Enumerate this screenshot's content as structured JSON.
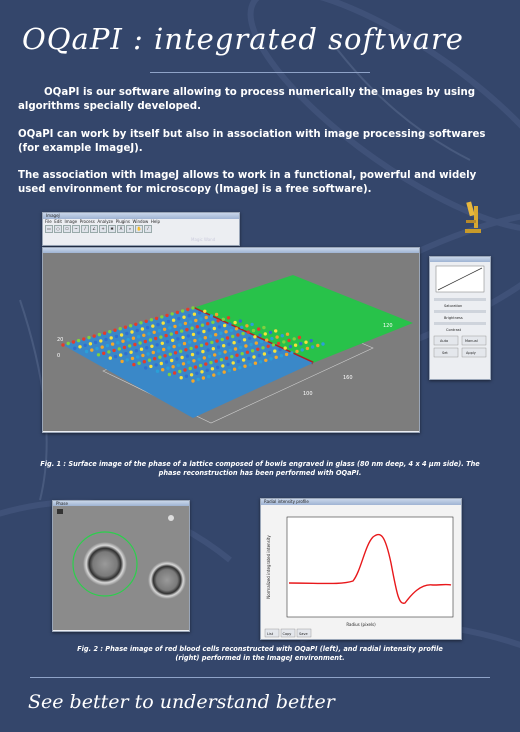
{
  "title": "OQaPI : integrated software",
  "paragraphs": [
    "OQaPI is our software allowing to process numerically the images by using algorithms specially developed.",
    "OQaPI can work by itself but also in association with image processing softwares (for example ImageJ).",
    "The association with ImageJ allows to work in a functional, powerful and widely used environment for microscopy (ImageJ is a free software)."
  ],
  "figure1": {
    "imagej_title": "ImageJ",
    "imagej_menu": [
      "File",
      "Edit",
      "Image",
      "Process",
      "Analyze",
      "Plugins",
      "Window",
      "Help"
    ],
    "imagej_status": "Magic Wand",
    "caption": "Fig. 1 : Surface image of the phase of a lattice composed of bowls engraved in glass (80 nm deep, 4 x 4 µm side). The phase reconstruction has been performed with OQaPI.",
    "axis_labels": [
      "120",
      "160",
      "100",
      "20",
      "0"
    ],
    "panel_labels": [
      "Saturation",
      "Brightness",
      "Contrast",
      "Auto",
      "Manual",
      "Set",
      "Apply"
    ]
  },
  "figure2": {
    "cell_window_title": "Phase",
    "plot_window_title": "Radial intensity profile",
    "plot_buttons": [
      "List",
      "Copy",
      "Save"
    ],
    "plot_xlabel": "Radius (pixels)",
    "plot_ylabel": "Normalized integrated intensity",
    "caption": "Fig. 2 : Phase image of red blood cells reconstructed with OQaPI (left), and radial intensity profile (right) performed in the ImageJ environment."
  },
  "footer": "See better to understand better",
  "colors": {
    "background": "#34466b",
    "surface_green": "#28c24a",
    "plot_line": "#e8181b"
  }
}
